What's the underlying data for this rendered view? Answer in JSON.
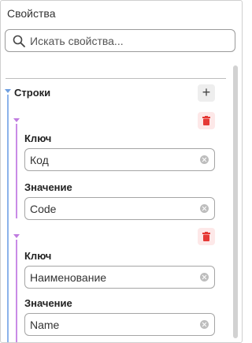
{
  "panel": {
    "title": "Свойства",
    "search": {
      "placeholder": "Искать свойства..."
    }
  },
  "section": {
    "label": "Строки",
    "add_label": "+",
    "entries": [
      {
        "key_label": "Ключ",
        "key_value": "Код",
        "value_label": "Значение",
        "value_value": "Code"
      },
      {
        "key_label": "Ключ",
        "key_value": "Наименование",
        "value_label": "Значение",
        "value_value": "Name"
      }
    ]
  },
  "icons": {
    "search": "search-icon",
    "add": "plus-icon",
    "delete": "trash-icon",
    "clear": "clear-icon",
    "expand": "triangle-down-icon"
  },
  "colors": {
    "tree_blue": "#8cb3ea",
    "tree_purple": "#c98be6",
    "delete_red": "#e53935"
  }
}
